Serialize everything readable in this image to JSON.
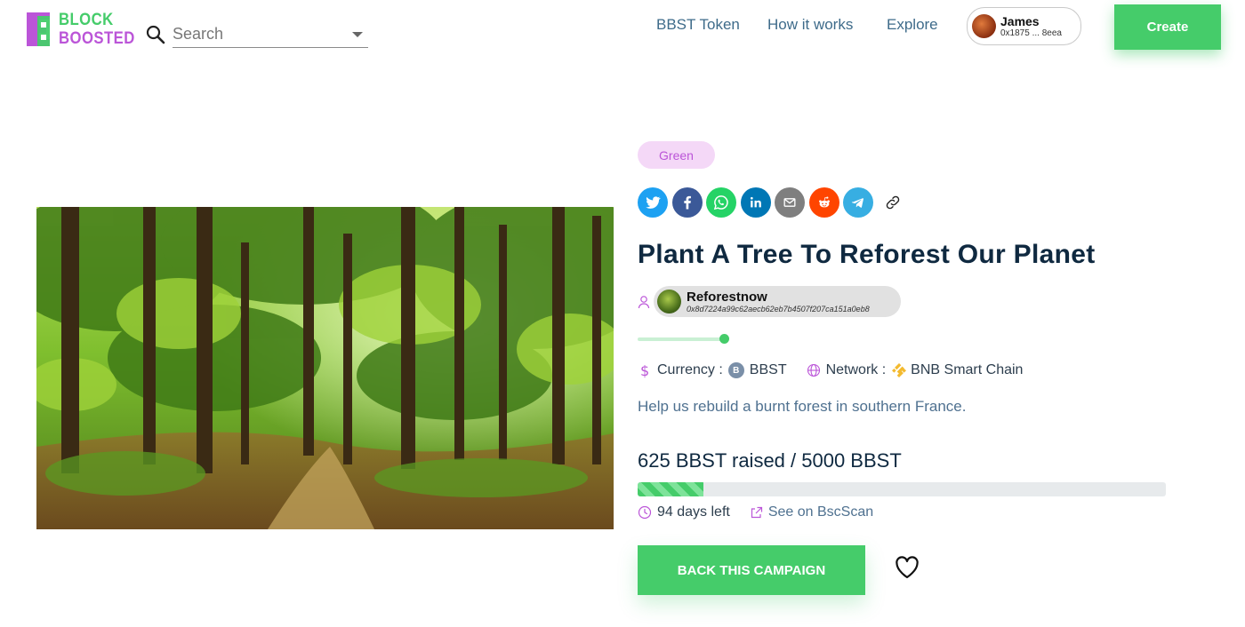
{
  "brand": {
    "line1": "BLOCK",
    "line2": "BOOSTED"
  },
  "search": {
    "placeholder": "Search"
  },
  "nav": {
    "bbst_token": "BBST Token",
    "how_it_works": "How it works",
    "explore": "Explore"
  },
  "user": {
    "name": "James",
    "address": "0x1875 ... 8eea"
  },
  "create_label": "Create",
  "campaign": {
    "tag": "Green",
    "share_icons": [
      "twitter-icon",
      "facebook-icon",
      "whatsapp-icon",
      "linkedin-icon",
      "email-icon",
      "reddit-icon",
      "telegram-icon",
      "link-icon"
    ],
    "title": "Plant A Tree To Reforest Our Planet",
    "owner": {
      "name": "Reforestnow",
      "address": "0x8d7224a99c62aecb62eb7b4507f207ca151a0eb8"
    },
    "currency_label": "Currency :",
    "currency_value": "BBST",
    "network_label": "Network :",
    "network_value": "BNB Smart Chain",
    "description": "Help us rebuild a burnt forest in southern France.",
    "raised_text": "625 BBST raised / 5000 BBST",
    "raised": 625,
    "goal": 5000,
    "days_left": "94 days left",
    "explorer_link": "See on BscScan",
    "back_label": "BACK THIS CAMPAIGN"
  },
  "colors": {
    "accent_green": "#45cc6a",
    "accent_purple": "#bb55d8",
    "title_navy": "#0f2940",
    "muted_blue": "#4f7190",
    "twitter": "#1da1f2",
    "facebook": "#3b5998",
    "whatsapp": "#25d366",
    "linkedin": "#0077b5",
    "email": "#7f7f7f",
    "reddit": "#ff4500",
    "telegram": "#37aee2"
  }
}
